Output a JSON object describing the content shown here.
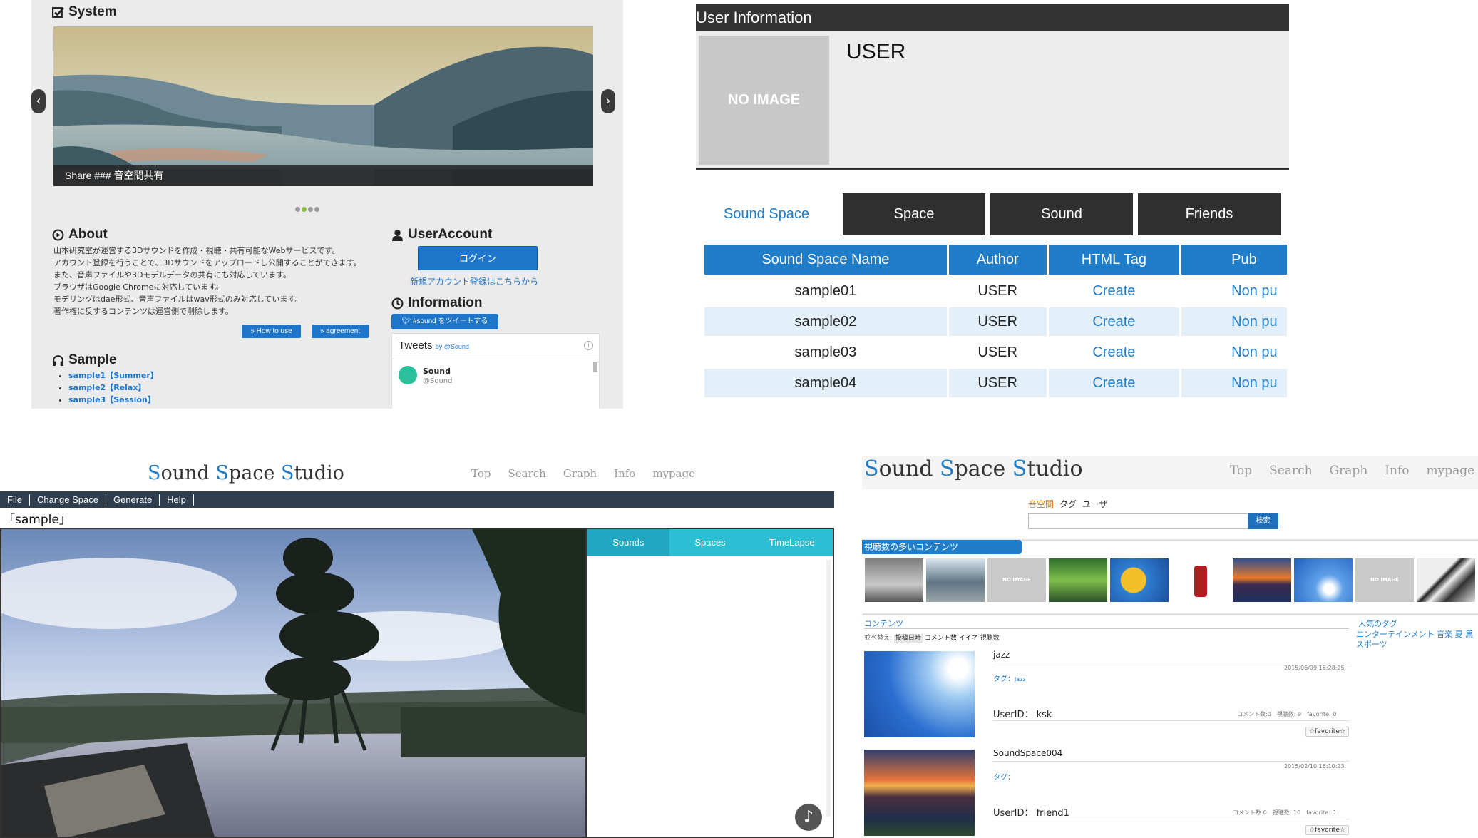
{
  "panelA": {
    "system_title": "System",
    "carousel_caption": "Share ### 音空間共有",
    "about_title": "About",
    "about_lines": [
      "山本研究室が運営する3Dサウンドを作成・視聴・共有可能なWebサービスです。",
      "アカウント登録を行うことで、3Dサウンドをアップロードし公開することができます。",
      "また、音声ファイルや3Dモデルデータの共有にも対応しています。",
      "ブラウザはGoogle Chromeに対応しています。",
      "モデリングはdae形式、音声ファイルはwav形式のみ対応しています。",
      "著作権に反するコンテンツは運営側で削除します。"
    ],
    "how_to_use": "How to use",
    "agreement": "agreement",
    "sample_title": "Sample",
    "samples": [
      "sample1【Summer】",
      "sample2【Relax】",
      "sample3【Session】"
    ],
    "useraccount_title": "UserAccount",
    "login_label": "ログイン",
    "register_link": "新規アカウント登録はこちらから",
    "information_title": "Information",
    "tweet_button": "#sound をツイートする",
    "tweets_label": "Tweets",
    "tweets_by": "by @Sound",
    "tweet_user_name": "Sound",
    "tweet_user_handle": "@Sound"
  },
  "panelB": {
    "title": "User Information",
    "no_image": "NO IMAGE",
    "username": "USER",
    "tabs": [
      "Sound Space",
      "Space",
      "Sound",
      "Friends"
    ],
    "columns": [
      "Sound Space Name",
      "Author",
      "HTML Tag",
      "Pub"
    ],
    "rows": [
      {
        "name": "sample01",
        "author": "USER",
        "tag": "Create",
        "pub": "Non pu"
      },
      {
        "name": "sample02",
        "author": "USER",
        "tag": "Create",
        "pub": "Non pu"
      },
      {
        "name": "sample03",
        "author": "USER",
        "tag": "Create",
        "pub": "Non pu"
      },
      {
        "name": "sample04",
        "author": "USER",
        "tag": "Create",
        "pub": "Non pu"
      }
    ]
  },
  "panelC": {
    "brand": {
      "s": "S",
      "ound": "ound ",
      "sp": "S",
      "pace": "pace ",
      "st": "S",
      "tudio": "tudio"
    },
    "nav": [
      "Top",
      "Search",
      "Graph",
      "Info",
      "mypage"
    ],
    "menu": [
      "File",
      "Change Space",
      "Generate",
      "Help"
    ],
    "space_name": "「sample」",
    "side_tabs": [
      "Sounds",
      "Spaces",
      "TimeLapse"
    ],
    "music_icon": "♪"
  },
  "panelD": {
    "nav": [
      "Top",
      "Search",
      "Graph",
      "Info",
      "mypage"
    ],
    "search_tabs": [
      "音空間",
      "タグ",
      "ユーザ"
    ],
    "search_button": "検索",
    "popular_title": "視聴数の多いコンテンツ",
    "no_image": "NO IMAGE",
    "contents_title": "コンテンツ",
    "sort_label": "並べ替え:",
    "sort_options": [
      "投稿日時",
      "コメント数",
      "イイネ",
      "視聴数"
    ],
    "popular_tags_title": "人気のタグ",
    "popular_tags": "エンターテインメント 音楽 夏 馬 スポーツ",
    "items": [
      {
        "title": "jazz",
        "date": "2015/06/09 16:28:25",
        "tag_label": "タグ：",
        "tag": "jazz",
        "user": "UserID： ksk",
        "stats": "コメント数:0　視聴数: 9　favorite: 0",
        "fav": "☆favorite☆"
      },
      {
        "title": "SoundSpace004",
        "date": "2015/02/10 16:10:23",
        "tag_label": "タグ：",
        "tag": "",
        "user": "UserID： friend1",
        "stats": "コメント数:0　視聴数: 10　favorite: 0",
        "fav": "☆favorite☆"
      }
    ]
  },
  "colors": {
    "accent_blue": "#1f7dc9",
    "dark": "#2f2f2f",
    "cyan": "#2cbfd4"
  }
}
